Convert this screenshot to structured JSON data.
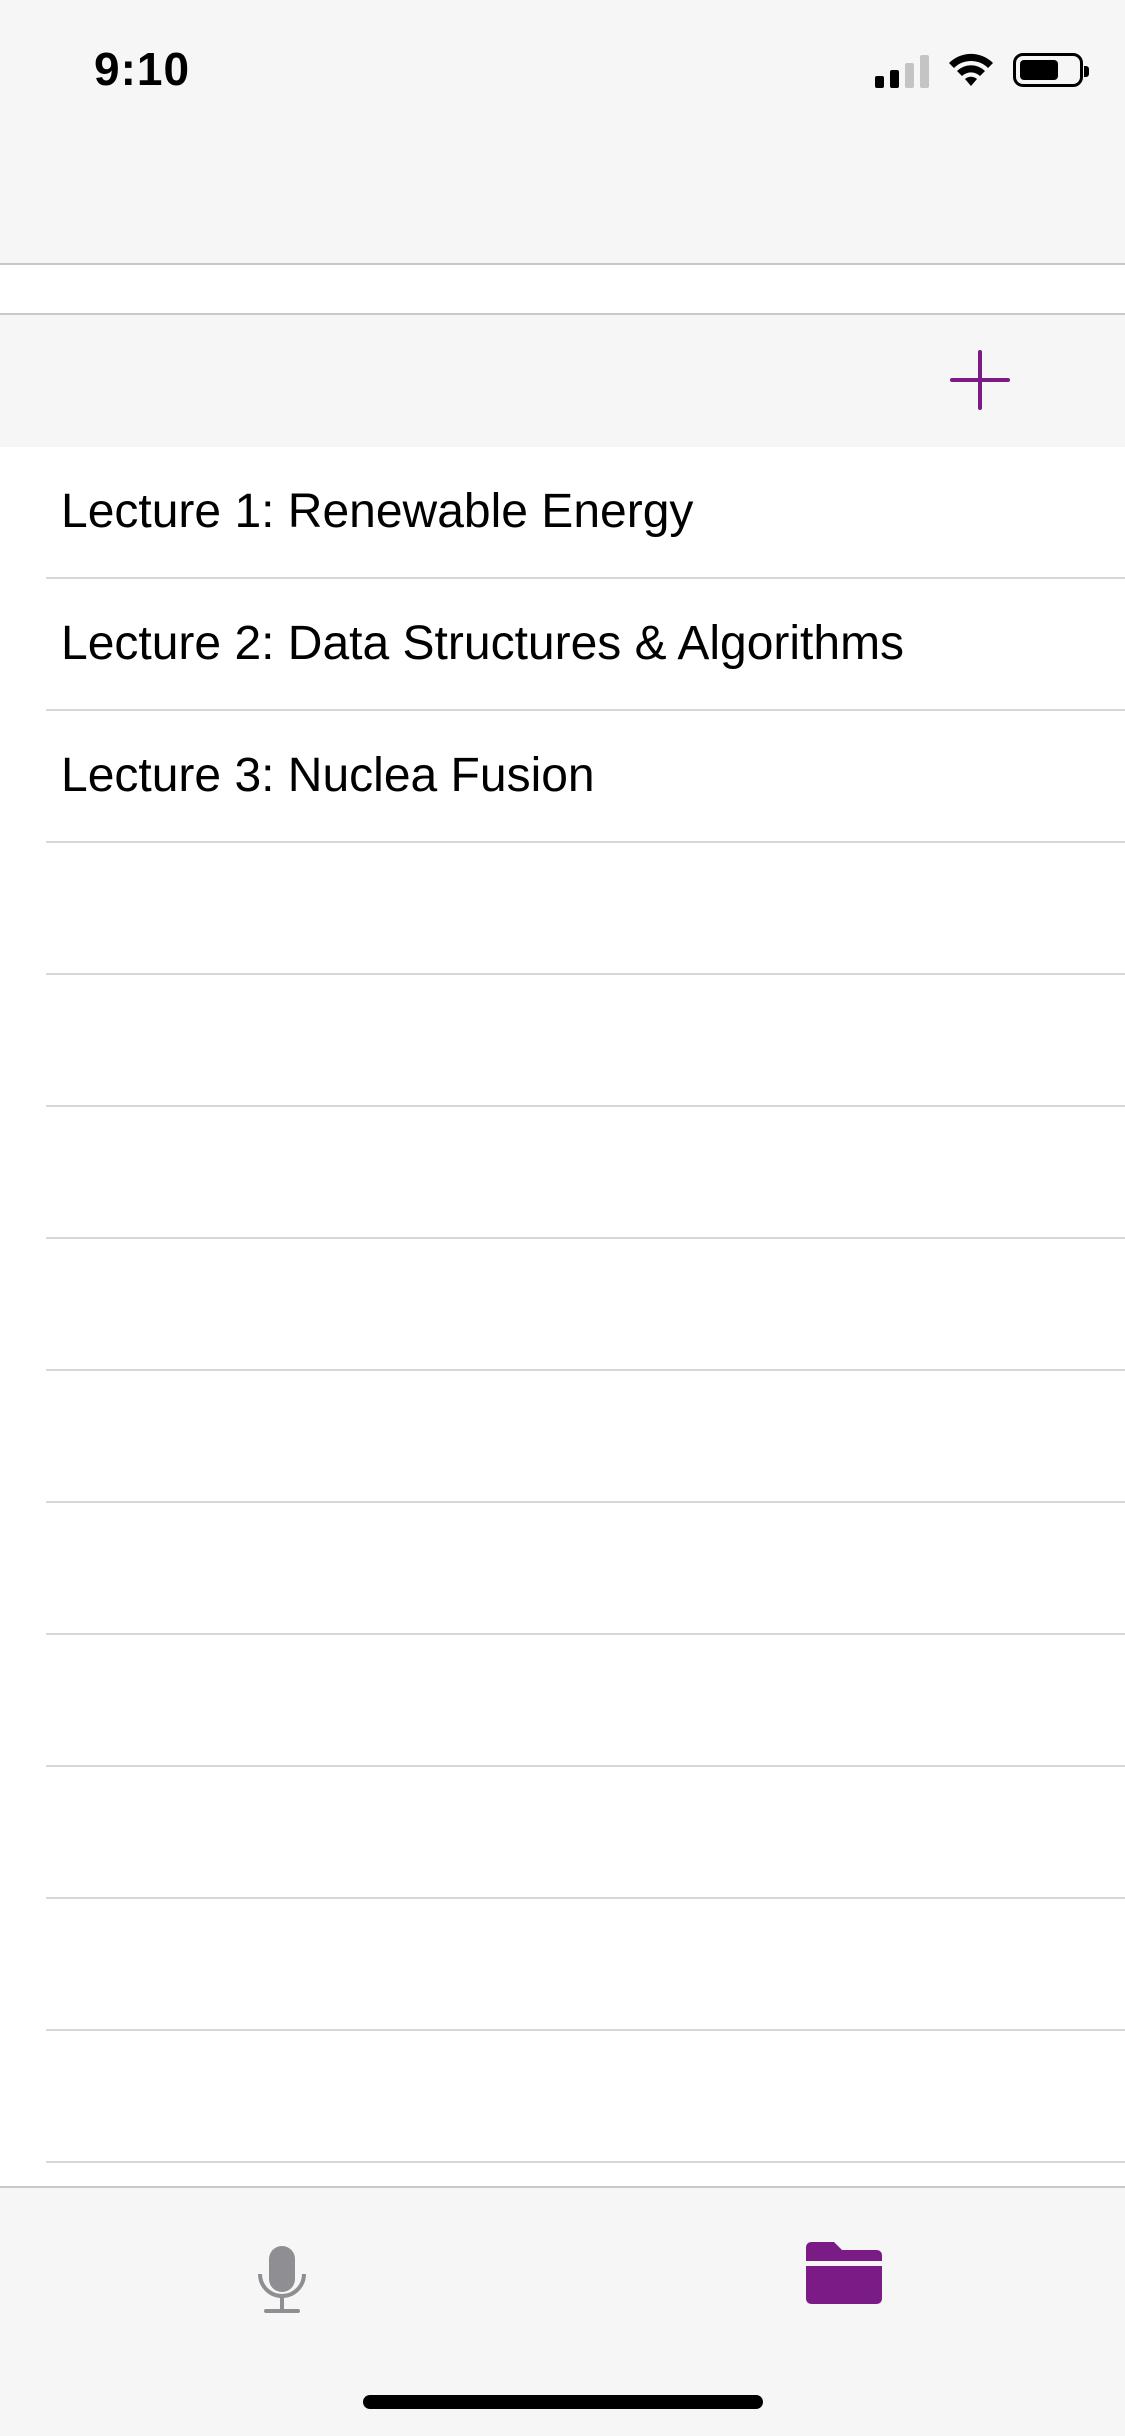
{
  "status_bar": {
    "time": "9:10"
  },
  "toolbar": {
    "add_icon": "plus-icon"
  },
  "lectures": [
    {
      "title": "Lecture 1: Renewable Energy"
    },
    {
      "title": "Lecture 2: Data Structures & Algorithms"
    },
    {
      "title": "Lecture 3: Nuclea Fusion"
    },
    {
      "title": ""
    },
    {
      "title": ""
    },
    {
      "title": ""
    },
    {
      "title": ""
    },
    {
      "title": ""
    },
    {
      "title": ""
    },
    {
      "title": ""
    },
    {
      "title": ""
    },
    {
      "title": ""
    },
    {
      "title": ""
    },
    {
      "title": ""
    },
    {
      "title": ""
    },
    {
      "title": ""
    },
    {
      "title": ""
    }
  ],
  "tab_bar": {
    "tabs": [
      {
        "icon": "microphone-icon",
        "selected": false
      },
      {
        "icon": "folder-icon",
        "selected": true
      }
    ]
  },
  "colors": {
    "accent": "#7b1c86",
    "inactive_icon": "#8e8e93",
    "bar_background": "#f6f6f6",
    "separator": "#d6d6d6"
  }
}
